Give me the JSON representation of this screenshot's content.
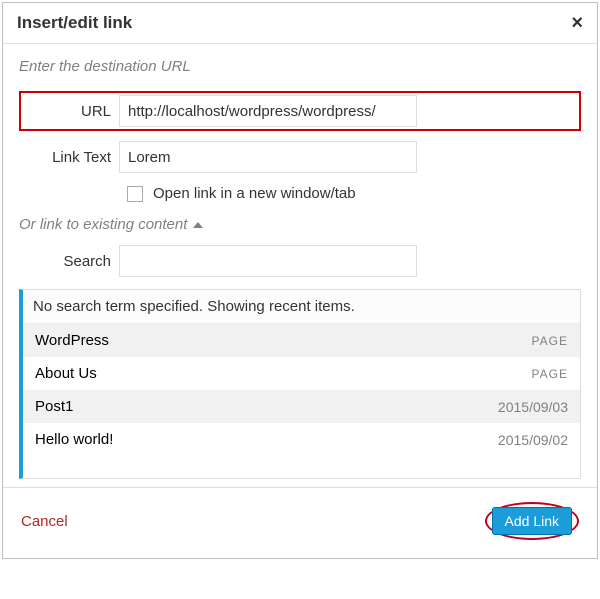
{
  "header": {
    "title": "Insert/edit link",
    "close_symbol": "×"
  },
  "hint": "Enter the destination URL",
  "form": {
    "url_label": "URL",
    "url_value": "http://localhost/wordpress/wordpress/",
    "linktext_label": "Link Text",
    "linktext_value": "Lorem",
    "newtab_label": "Open link in a new window/tab"
  },
  "existing": {
    "toggle_label": "Or link to existing content",
    "search_label": "Search",
    "search_value": "",
    "notice": "No search term specified. Showing recent items.",
    "items": [
      {
        "title": "WordPress",
        "meta": "PAGE",
        "meta_kind": "type",
        "alt": true
      },
      {
        "title": "About Us",
        "meta": "PAGE",
        "meta_kind": "type",
        "alt": false
      },
      {
        "title": "Post1",
        "meta": "2015/09/03",
        "meta_kind": "date",
        "alt": true
      },
      {
        "title": "Hello world!",
        "meta": "2015/09/02",
        "meta_kind": "date",
        "alt": false
      }
    ]
  },
  "footer": {
    "cancel_label": "Cancel",
    "submit_label": "Add Link"
  }
}
